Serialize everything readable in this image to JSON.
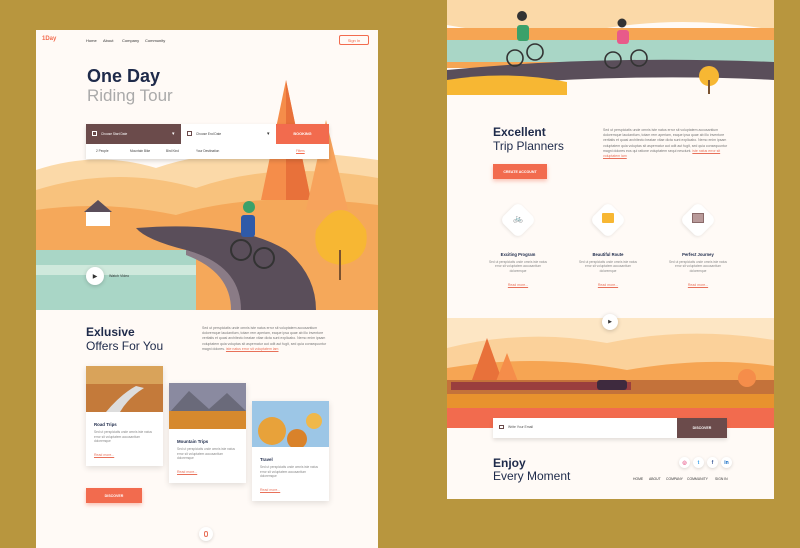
{
  "left": {
    "brand": "1Day",
    "nav": [
      "Home",
      "About",
      "Company",
      "Community"
    ],
    "signin": "Sign In",
    "hero_title_1": "One Day",
    "hero_title_2": "Riding Tour",
    "search": {
      "start_date": "Choose Start Date",
      "end_date": "Choose End Date",
      "booking": "BOOKING",
      "people": "2 People",
      "bike": "Mountain Bike",
      "ride_kind": "Bird Kind",
      "destination": "Your Destination",
      "filters": "Filters"
    },
    "watch_video": "Watch Video",
    "offers_title_1": "Exlusive",
    "offers_title_2": "Offers For You",
    "offers_text": "Sed ut perspiciatis unde omnis iste natus error sit voluptatem accusantium doloremque laudantium, totam rem aperiam, eaque ipsa quae ab illo inventore veritatis et quasi architecto beatae vitae dicta sunt explicabo. Nemo enim ipsam voluptatem quia voluptas sit aspernatur aut odit aut fugit, sed quia consequuntur magni dolores.",
    "offers_link": "iste natus error sit voluptatem lam",
    "cards": [
      {
        "title": "Road Trips",
        "text": "Sed ut perspiciatis unde omnis iste natus error sit voluptatem accusantium doloremque",
        "link": "Read more..."
      },
      {
        "title": "Mountain Trips",
        "text": "Sed ut perspiciatis unde omnis iste natus error sit voluptatem accusantium doloremque",
        "link": "Read more..."
      },
      {
        "title": "Travel",
        "text": "Sed ut perspiciatis unde omnis iste natus error sit voluptatem accusantium doloremque",
        "link": "Read more..."
      }
    ],
    "discover": "DISCOVER"
  },
  "right": {
    "trip_title_1": "Excellent",
    "trip_title_2": "Trip Planners",
    "trip_text": "Sed ut perspiciatis unde omnis iste natus error sit voluptatem accusantium doloremque laudantium, totam rem aperiam, eaque ipsa quae ab illo inventore veritatis et quasi architecto beatae vitae dicta sunt explicabo. Nemo enim ipsam voluptatem quia voluptas sit aspernatur aut odit aut fugit, sed quia consequuntur magni dolores eos qui ratione voluptatem sequi nesciunt.",
    "trip_link": "iste natus error sit voluptatem lam",
    "create_account": "CREATE ACCOUNT",
    "features": [
      {
        "title": "Exciting Program",
        "text": "Sed ut perspiciatis unde omnis iste natus error sit voluptatem accusantium doloremque",
        "link": "Read more..."
      },
      {
        "title": "Beautiful Route",
        "text": "Sed ut perspiciatis unde omnis iste natus error sit voluptatem accusantium doloremque",
        "link": "Read more..."
      },
      {
        "title": "Perfect Journey",
        "text": "Sed ut perspiciatis unde omnis iste natus error sit voluptatem accusantium doloremque",
        "link": "Read more..."
      }
    ],
    "email_placeholder": "Write Your Email",
    "discover": "DISCOVER",
    "enjoy_1": "Enjoy",
    "enjoy_2": "Every Moment",
    "footer_nav": [
      "HOME",
      "ABOUT",
      "COMPANY",
      "COMMUNITY",
      "SIGN IN"
    ],
    "social": [
      "instagram-icon",
      "twitter-icon",
      "facebook-icon",
      "linkedin-icon"
    ]
  },
  "colors": {
    "background": "#b8963e",
    "accent": "#f26b4e",
    "navy": "#1e2a4a",
    "panel": "#fffaf6"
  }
}
